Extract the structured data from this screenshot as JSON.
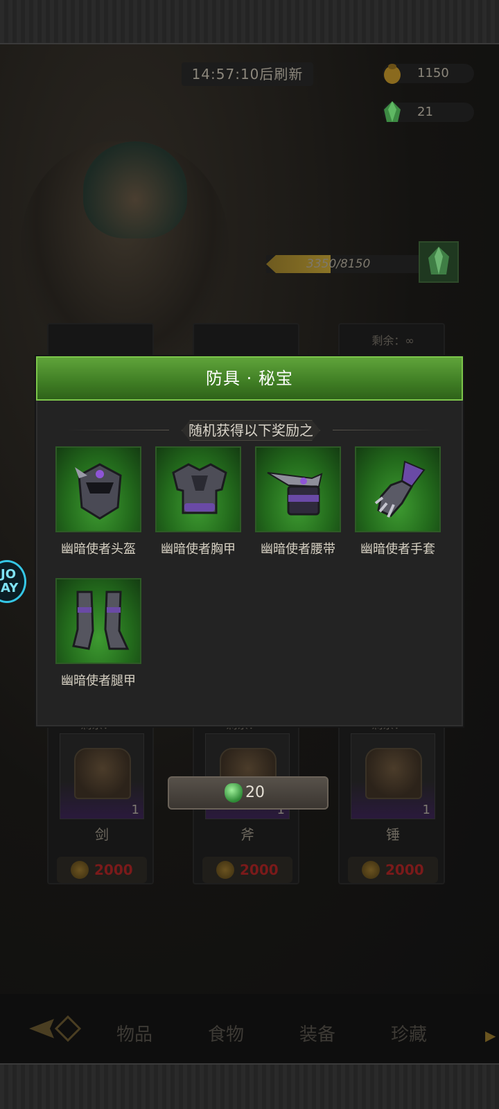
{
  "timer": "14:57:10后刷新",
  "currencies": [
    {
      "icon": "gold-coin-pouch-icon",
      "value": "1150"
    },
    {
      "icon": "green-crystal-icon",
      "value": "21"
    }
  ],
  "progress": {
    "text": "3350/8150",
    "fraction": 0.41
  },
  "shop_cards": [
    {
      "remaining": "剩余：∞",
      "name": "剑",
      "qty": "1",
      "price": "2000"
    },
    {
      "remaining": "剩余：∞",
      "name": "斧",
      "qty": "1",
      "price": "2000"
    },
    {
      "remaining": "剩余：∞",
      "name": "锤",
      "qty": "1",
      "price": "2000"
    }
  ],
  "top_card_remaining": "剩余：∞",
  "cost_button": {
    "icon": "green-crystal-icon",
    "value": "20"
  },
  "tabs": [
    "物品",
    "食物",
    "装备",
    "珍藏"
  ],
  "side_bubble": "JO\nAY",
  "modal": {
    "title": "防具 · 秘宝",
    "subtitle": "随机获得以下奖励之一",
    "rewards": [
      {
        "label": "幽暗使者头盔",
        "icon": "helmet-icon"
      },
      {
        "label": "幽暗使者胸甲",
        "icon": "chest-armor-icon"
      },
      {
        "label": "幽暗使者腰带",
        "icon": "belt-icon"
      },
      {
        "label": "幽暗使者手套",
        "icon": "gauntlet-icon"
      },
      {
        "label": "幽暗使者腿甲",
        "icon": "greaves-icon"
      }
    ]
  },
  "colors": {
    "accent_green": "#4f9a2f",
    "price_red": "#7a1a1a"
  }
}
